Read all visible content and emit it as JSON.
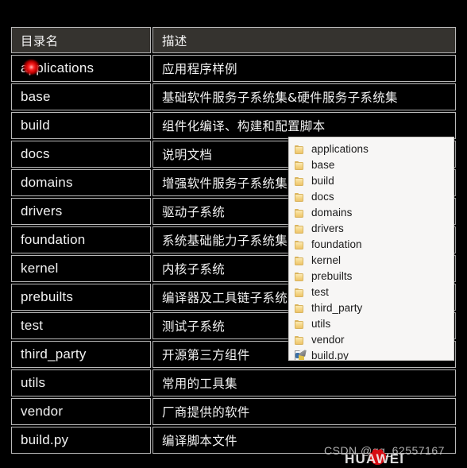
{
  "table": {
    "headers": [
      "目录名",
      "描述"
    ],
    "rows": [
      {
        "name": "applications",
        "desc": "应用程序样例"
      },
      {
        "name": "base",
        "desc": "基础软件服务子系统集&硬件服务子系统集"
      },
      {
        "name": "build",
        "desc": "组件化编译、构建和配置脚本"
      },
      {
        "name": "docs",
        "desc": "说明文档"
      },
      {
        "name": "domains",
        "desc": "增强软件服务子系统集"
      },
      {
        "name": "drivers",
        "desc": "驱动子系统"
      },
      {
        "name": "foundation",
        "desc": "系统基础能力子系统集"
      },
      {
        "name": "kernel",
        "desc": "内核子系统"
      },
      {
        "name": "prebuilts",
        "desc": "编译器及工具链子系统"
      },
      {
        "name": "test",
        "desc": "测试子系统"
      },
      {
        "name": "third_party",
        "desc": "开源第三方组件"
      },
      {
        "name": "utils",
        "desc": "常用的工具集"
      },
      {
        "name": "vendor",
        "desc": "厂商提供的软件"
      },
      {
        "name": "build.py",
        "desc": "编译脚本文件"
      }
    ]
  },
  "file_overlay": {
    "items": [
      {
        "label": "applications",
        "icon": "folder-icon"
      },
      {
        "label": "base",
        "icon": "folder-icon"
      },
      {
        "label": "build",
        "icon": "folder-icon"
      },
      {
        "label": "docs",
        "icon": "folder-icon"
      },
      {
        "label": "domains",
        "icon": "folder-icon"
      },
      {
        "label": "drivers",
        "icon": "folder-icon"
      },
      {
        "label": "foundation",
        "icon": "folder-icon"
      },
      {
        "label": "kernel",
        "icon": "folder-icon"
      },
      {
        "label": "prebuilts",
        "icon": "folder-icon"
      },
      {
        "label": "test",
        "icon": "folder-icon"
      },
      {
        "label": "third_party",
        "icon": "folder-icon"
      },
      {
        "label": "utils",
        "icon": "folder-icon"
      },
      {
        "label": "vendor",
        "icon": "folder-icon"
      },
      {
        "label": "build.py",
        "icon": "python-file-icon"
      }
    ]
  },
  "watermark": {
    "csdn_text": "CSDN @qq_62557167",
    "brand": "HUAWEI"
  },
  "colors": {
    "background": "#000000",
    "header_bg": "#35332f",
    "border": "#b9b9b9",
    "text": "#f2f2f2",
    "overlay_bg": "#f7f6f5",
    "folder": "#f6d98c",
    "laser": "#ff2a2a",
    "huawei_red": "#d60b12"
  }
}
